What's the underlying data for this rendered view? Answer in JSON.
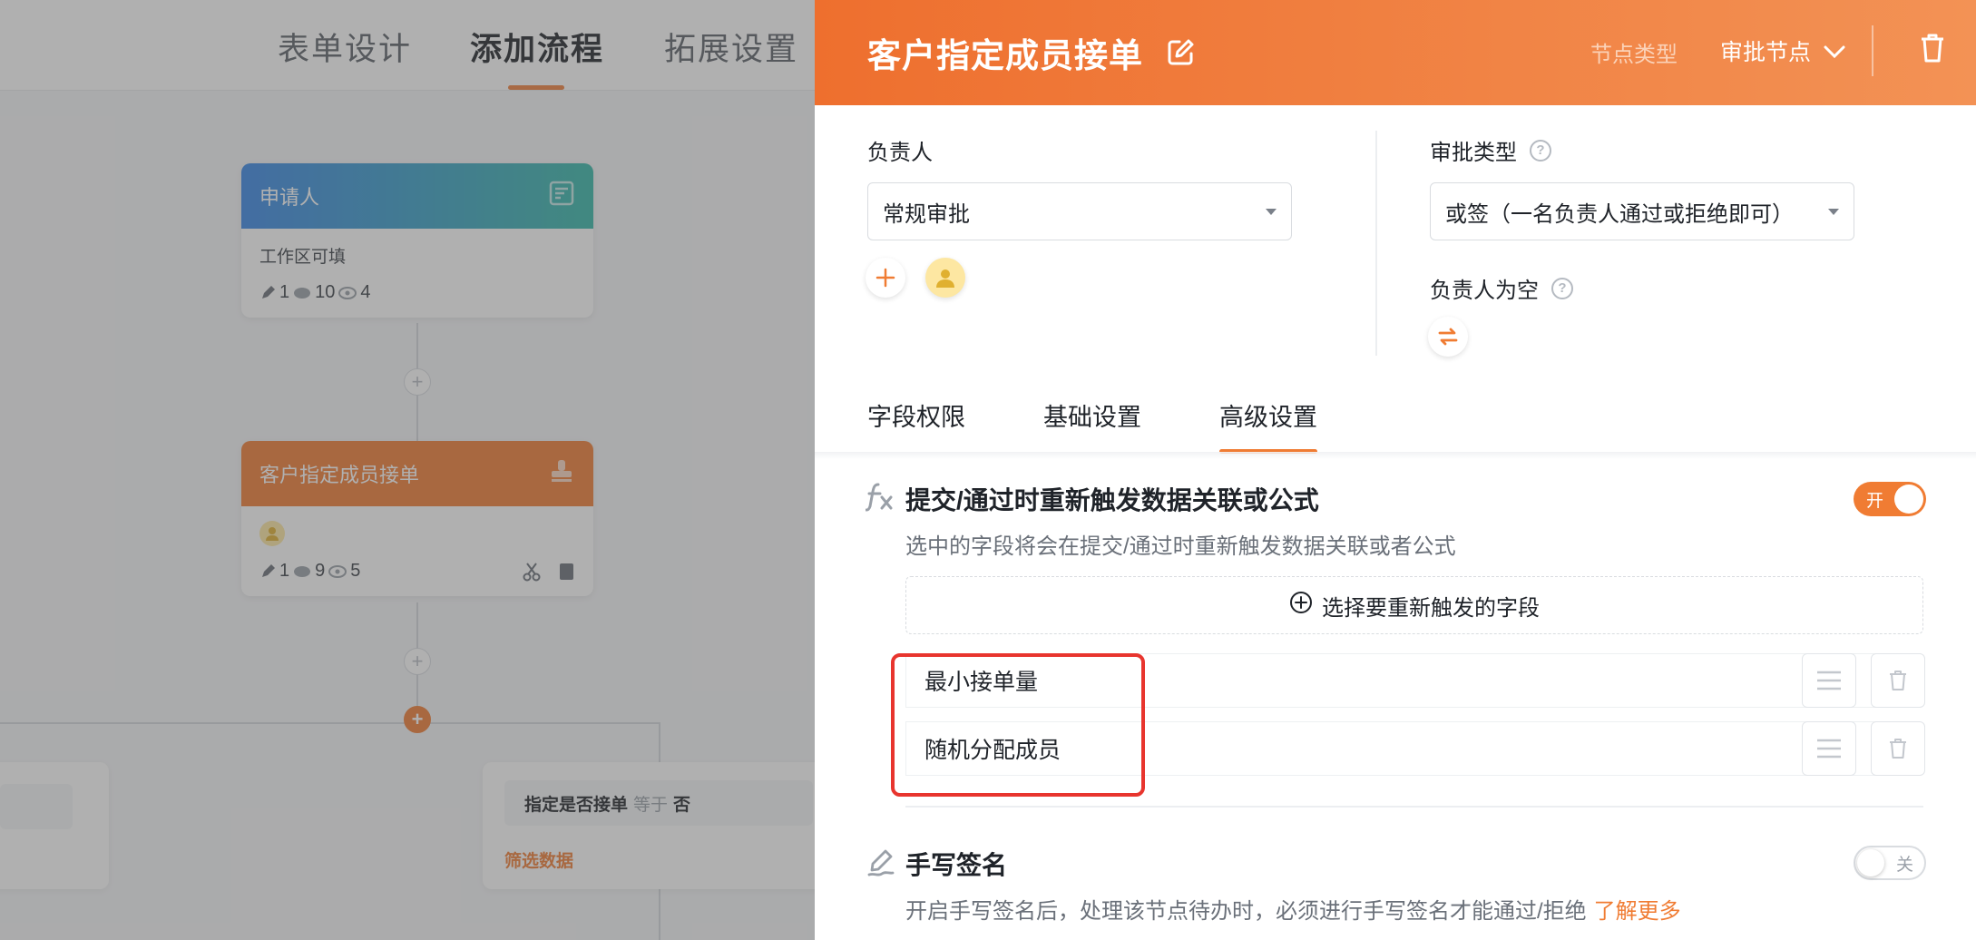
{
  "canvas": {
    "tabs": [
      "表单设计",
      "添加流程",
      "拓展设置"
    ],
    "active_tab": 1,
    "applicant_node": {
      "title": "申请人",
      "body": "工作区可填",
      "stats": [
        "1",
        "10",
        "4"
      ]
    },
    "assign_node": {
      "title": "客户指定成员接单",
      "stats": [
        "1",
        "9",
        "5"
      ]
    },
    "condition": {
      "field": "指定是否接单",
      "operator": "等于",
      "value": "否",
      "filter_label": "筛选数据"
    }
  },
  "drawer": {
    "title": "客户指定成员接单",
    "node_type_label": "节点类型",
    "node_type_value": "审批节点",
    "owner": {
      "label": "负责人",
      "select_value": "常规审批"
    },
    "approval_type": {
      "label": "审批类型",
      "select_value": "或签（一名负责人通过或拒绝即可）"
    },
    "empty_owner": {
      "label": "负责人为空"
    },
    "tabs": [
      "字段权限",
      "基础设置",
      "高级设置"
    ],
    "active_tab": 2,
    "retrigger": {
      "title": "提交/通过时重新触发数据关联或公式",
      "desc": "选中的字段将会在提交/通过时重新触发数据关联或者公式",
      "toggle_label": "开",
      "enabled": true,
      "select_button": "选择要重新触发的字段",
      "fields": [
        "最小接单量",
        "随机分配成员"
      ]
    },
    "signature": {
      "title": "手写签名",
      "desc": "开启手写签名后，处理该节点待办时，必须进行手写签名才能通过/拒绝",
      "learn_more": "了解更多",
      "toggle_label": "关",
      "enabled": false
    }
  },
  "colors": {
    "accent": "#f07c33",
    "highlight": "#e8352e"
  }
}
